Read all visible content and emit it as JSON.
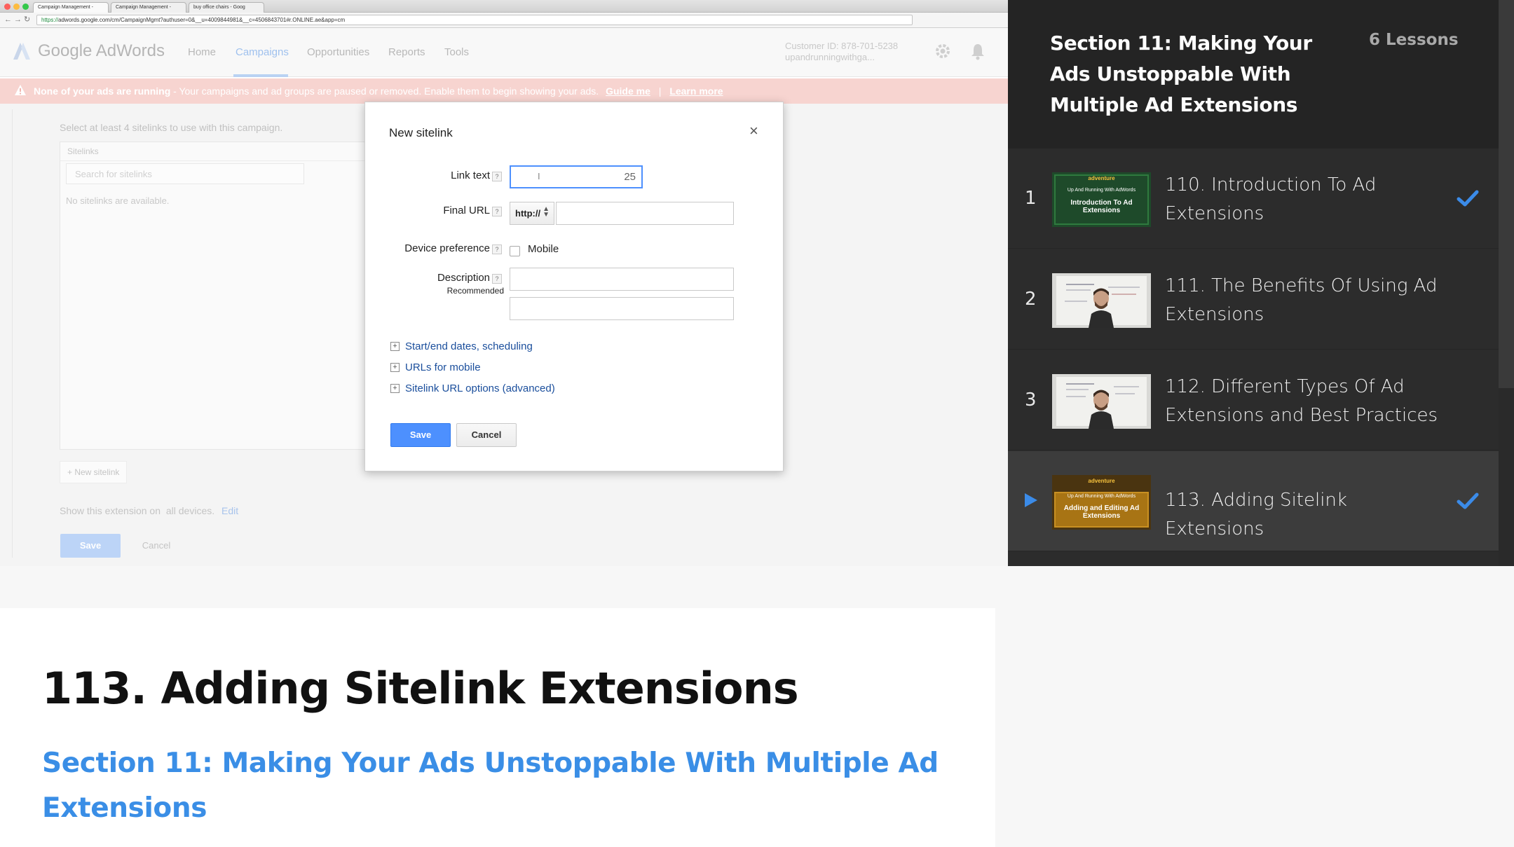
{
  "browser": {
    "tabs": [
      "Campaign Management - ",
      "Campaign Management - ",
      "buy office chairs - Goog"
    ],
    "url_https": "https://",
    "url_rest": "adwords.google.com/cm/CampaignMgmt?authuser=0&__u=4009844981&__c=4506843701#r.ONLINE.ae&app=cm"
  },
  "adwords": {
    "logo_text": "Google AdWords",
    "nav": [
      "Home",
      "Campaigns",
      "Opportunities",
      "Reports",
      "Tools"
    ],
    "customer_id": "Customer ID: 878-701-5238",
    "account": "upandrunningwithga...",
    "warning_bold": "None of your ads are running",
    "warning_text": " - Your campaigns and ad groups are paused or removed. Enable them to begin showing your ads.",
    "guide_me": "Guide me",
    "learn_more": "Learn more",
    "select_hint": "Select at least 4 sitelinks to use with this campaign.",
    "sitelinks_header": "Sitelinks",
    "search_placeholder": "Search for sitelinks",
    "no_sitelinks": "No sitelinks are available.",
    "new_sitelink_btn": "New sitelink",
    "show_ext": "Show this extension on",
    "all_devices": "all devices.",
    "edit": "Edit",
    "save": "Save",
    "cancel": "Cancel"
  },
  "dialog": {
    "title": "New sitelink",
    "close": "×",
    "link_text_label": "Link text",
    "link_text_count": "25",
    "final_url_label": "Final URL",
    "http_option": "http://",
    "device_pref_label": "Device preference",
    "mobile_label": "Mobile",
    "description_label": "Description",
    "recommended": "Recommended",
    "expanders": [
      "Start/end dates, scheduling",
      "URLs for mobile",
      "Sitelink URL options (advanced)"
    ],
    "save": "Save",
    "cancel": "Cancel"
  },
  "sidebar": {
    "section_title": "Section 11: Making Your Ads Unstoppable With Multiple Ad Extensions",
    "lesson_count": "6 Lessons",
    "lessons": [
      {
        "num": "1",
        "title": "110. Introduction To Ad Extensions",
        "completed": true,
        "current": false,
        "thumb": {
          "kind": "green",
          "brand": "adventure",
          "sub": "Up And Running With AdWords",
          "main": "Introduction To Ad Extensions"
        }
      },
      {
        "num": "2",
        "title": "111. The Benefits Of Using Ad Extensions",
        "completed": false,
        "current": false,
        "thumb": {
          "kind": "video"
        }
      },
      {
        "num": "3",
        "title": "112. Different Types Of Ad Extensions and Best Practices",
        "completed": false,
        "current": false,
        "thumb": {
          "kind": "video"
        }
      },
      {
        "num": "",
        "title": "113. Adding Sitelink Extensions",
        "completed": true,
        "current": true,
        "thumb": {
          "kind": "gold",
          "brand": "adventure",
          "sub": "Up And Running With AdWords",
          "main": "Adding and Editing Ad Extensions"
        }
      }
    ]
  },
  "info": {
    "lesson_title": "113. Adding Sitelink Extensions",
    "section_link": "Section 11: Making Your Ads Unstoppable With Multiple Ad Extensions"
  },
  "colors": {
    "accent_blue": "#3a8ee6",
    "check_blue": "#3b8be8",
    "adwords_button": "#4d90fe"
  }
}
